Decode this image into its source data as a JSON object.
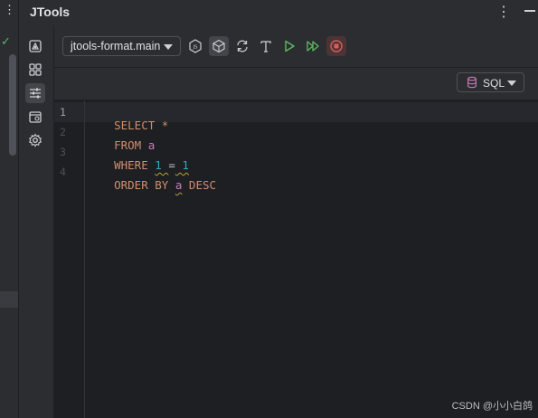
{
  "window": {
    "title": "JTools"
  },
  "toolbar": {
    "combo_value": "jtools-format.main",
    "buttons": [
      "js-icon",
      "package-icon",
      "refresh-icon",
      "format-text-icon",
      "run-icon",
      "run-all-icon",
      "stop-icon"
    ]
  },
  "sidebar": {
    "icons": [
      "plugin-icon",
      "grid-icon",
      "sliders-icon",
      "calendar-icon",
      "gear-icon"
    ]
  },
  "language": {
    "value": "SQL"
  },
  "editor": {
    "line_numbers": [
      "1",
      "2",
      "3",
      "4"
    ],
    "lines": [
      {
        "tokens": [
          {
            "t": "SELECT",
            "c": "kw"
          },
          {
            "t": " ",
            "c": "op"
          },
          {
            "t": "*",
            "c": "kw"
          }
        ]
      },
      {
        "tokens": [
          {
            "t": "FROM",
            "c": "kw"
          },
          {
            "t": " ",
            "c": "op"
          },
          {
            "t": "a",
            "c": "id"
          }
        ]
      },
      {
        "tokens": [
          {
            "t": "WHERE",
            "c": "kw"
          },
          {
            "t": " ",
            "c": "op"
          },
          {
            "t": "1 = 1",
            "c": "num-expr"
          }
        ]
      },
      {
        "tokens": [
          {
            "t": "ORDER BY",
            "c": "kw"
          },
          {
            "t": " ",
            "c": "op"
          },
          {
            "t": "a",
            "c": "id-squig"
          },
          {
            "t": " ",
            "c": "op"
          },
          {
            "t": "DESC",
            "c": "kw"
          }
        ]
      }
    ]
  },
  "watermark": "CSDN @小小白鸽",
  "colors": {
    "keyword": "#cf8e6d",
    "number": "#2aacb8",
    "identifier": "#c77dbb",
    "run": "#5fb865",
    "stop": "#db5c5c"
  }
}
